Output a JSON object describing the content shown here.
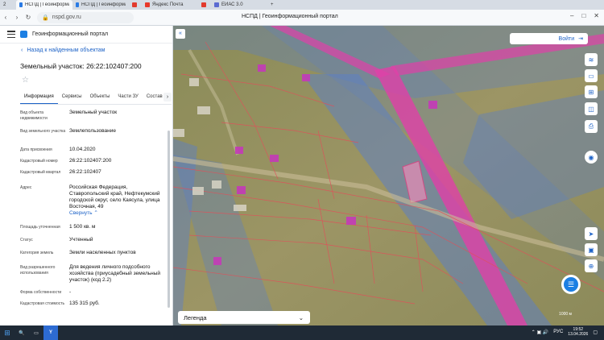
{
  "browser": {
    "tabs": [
      {
        "label": "НСПД | Геоинформационный портал",
        "color": "#2b7be4"
      },
      {
        "label": "НСПД | Геоинформационный портал",
        "color": "#2b7be4"
      },
      {
        "label": "",
        "color": "#e23b2e"
      },
      {
        "label": "Яндекс Почта",
        "color": "#e8392a"
      },
      {
        "label": "",
        "color": "#e23b2e"
      },
      {
        "label": "ЕИАС 3.0",
        "color": "#5b6bd1"
      }
    ],
    "url": "nspd.gov.ru",
    "page_title": "НСПД | Геоинформационный портал",
    "tab_count": "2"
  },
  "sidebar": {
    "portal_title": "Геоинформационный портал",
    "back_label": "Назад к найденным объектам",
    "parcel_title": "Земельный участок: 26:22:102407:200",
    "tabs": [
      "Информация",
      "Сервисы",
      "Объекты",
      "Части ЗУ",
      "Состав"
    ],
    "properties": [
      {
        "key": "Вид объекта недвижимости",
        "value": "Земельный участок"
      },
      {
        "key": "Вид земельного участка",
        "value": "Землепользование"
      },
      {
        "key": "Дата присвоения",
        "value": "10.04.2020"
      },
      {
        "key": "Кадастровый номер",
        "value": "26:22:102407:200"
      },
      {
        "key": "Кадастровый квартал",
        "value": "26:22:102407"
      },
      {
        "key": "Адрес",
        "value": "Российская Федерация, Ставропольский край, Нефтекумский городской округ, село Каясула, улица Восточная, 49"
      },
      {
        "key": "Площадь уточненная",
        "value": "1 500 кв. м"
      },
      {
        "key": "Статус",
        "value": "Учтенный"
      },
      {
        "key": "Категория земель",
        "value": "Земли населенных пунктов"
      },
      {
        "key": "Вид разрешенного использования",
        "value": "Для ведения личного подсобного хозяйства (приусадебный земельный участок) (код 2.2)"
      },
      {
        "key": "Форма собственности",
        "value": "-"
      },
      {
        "key": "Кадастровая стоимость",
        "value": "135 315 руб."
      }
    ],
    "collapse_label": "Свернуть"
  },
  "map": {
    "login_label": "Войти",
    "legend_label": "Легенда",
    "scale_text": "1000 м",
    "colors": {
      "pink_line": "#e040a8",
      "blue_zone": "#5a7ec9",
      "red_lines": "#e0505a"
    }
  },
  "taskbar": {
    "lang": "РУС",
    "time": "19:52",
    "date": "13.04.2026"
  }
}
